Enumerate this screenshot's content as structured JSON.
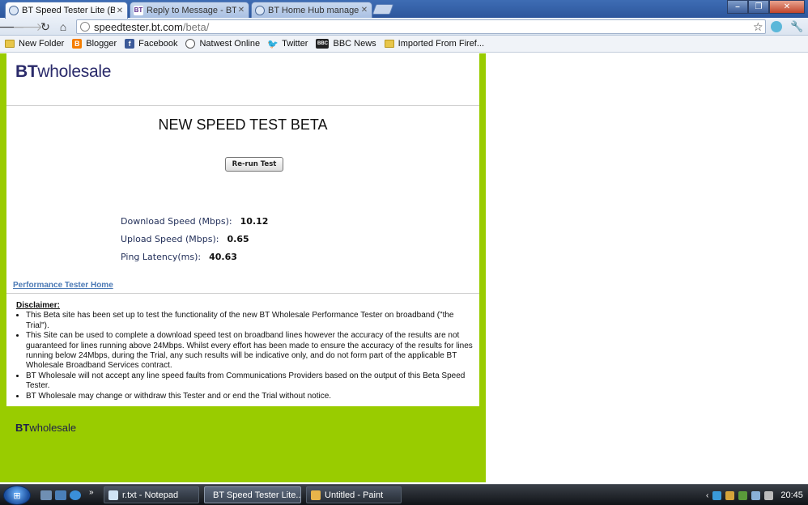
{
  "browser": {
    "tabs": [
      {
        "title": "BT Speed Tester Lite (Beta)",
        "active": true
      },
      {
        "title": "Reply to Message - BTCare",
        "active": false
      },
      {
        "title": "BT Home Hub manager - A",
        "active": false
      }
    ],
    "address": {
      "domain": "speedtester.bt.com",
      "path": "/beta/"
    },
    "bookmarks": [
      "New Folder",
      "Blogger",
      "Facebook",
      "Natwest Online",
      "Twitter",
      "BBC News",
      "Imported From Firef..."
    ]
  },
  "page": {
    "logo": {
      "bold": "BT",
      "text": "wholesale"
    },
    "heading": "NEW SPEED TEST BETA",
    "rerun_label": "Re-run Test",
    "results": {
      "download_label": "Download Speed (Mbps):",
      "download_value": "10.12",
      "upload_label": "Upload Speed (Mbps):",
      "upload_value": "0.65",
      "ping_label": "Ping Latency(ms):",
      "ping_value": "40.63"
    },
    "home_link": "Performance Tester Home",
    "disclaimer": {
      "title": "Disclaimer:",
      "items": [
        "This Beta site has been set up to test the functionality of the new BT Wholesale Performance Tester on broadband (\"the Trial\").",
        "This Site can be used to complete a download speed test on broadband lines however the accuracy of the results are not guaranteed for lines running above 24Mbps. Whilst every effort has been made to ensure the accuracy of the results for lines running below 24Mbps, during the Trial, any such results will be indicative only, and do not form part of the applicable BT Wholesale Broadband Services contract.",
        "BT Wholesale will not accept any line speed faults from Communications Providers based on the output of this Beta Speed Tester.",
        "BT Wholesale may change or withdraw this Tester and or end the Trial without notice."
      ]
    },
    "footer_logo": {
      "bold": "BT",
      "text": "wholesale"
    }
  },
  "taskbar": {
    "tasks": [
      {
        "title": "r.txt - Notepad",
        "active": false
      },
      {
        "title": "BT Speed Tester Lite...",
        "active": true
      },
      {
        "title": "Untitled - Paint",
        "active": false
      }
    ],
    "clock": "20:45"
  },
  "colors": {
    "page_green": "#99cc00",
    "link_blue": "#4b79b5",
    "bt_purple": "#2a2a6a"
  }
}
